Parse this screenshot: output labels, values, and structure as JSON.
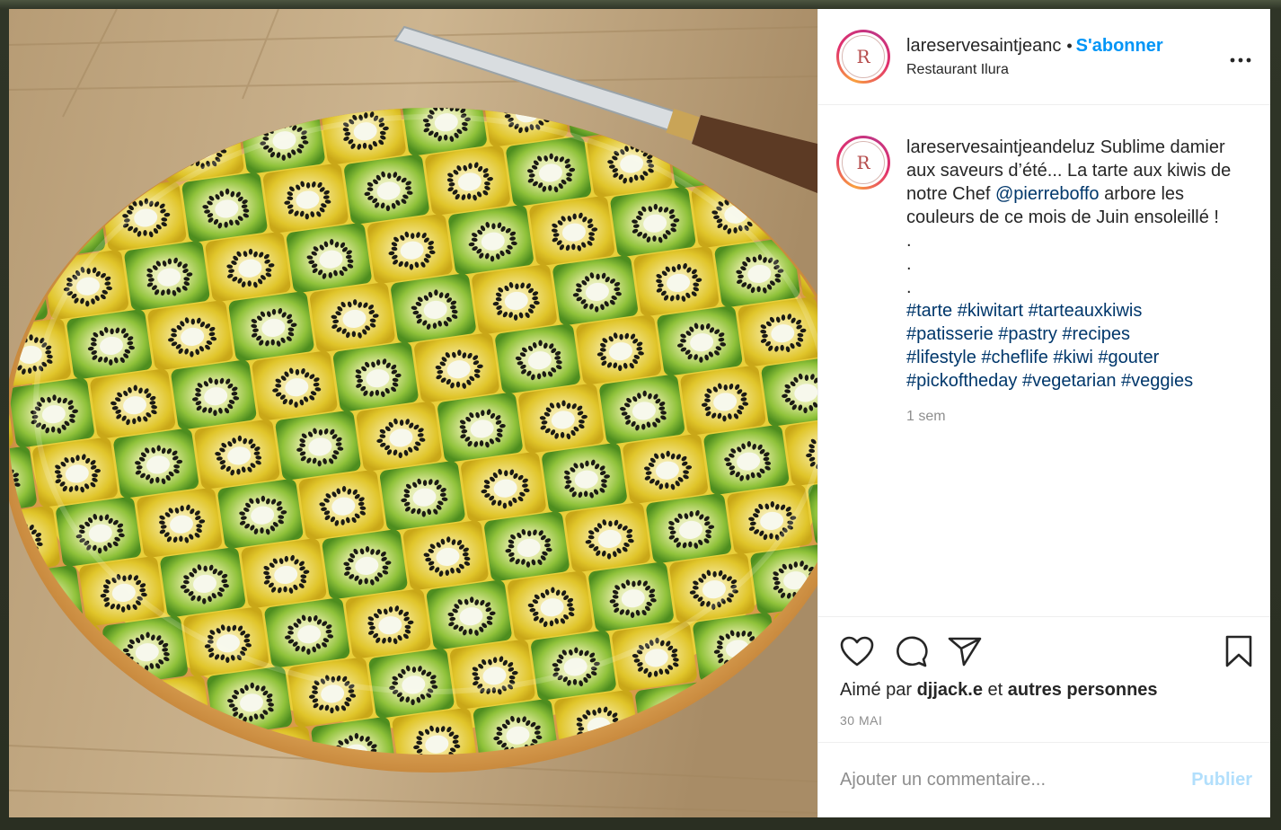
{
  "post": {
    "header": {
      "username": "lareservesaintjeanc",
      "separator": "•",
      "follow_label": "S'abonner",
      "location": "Restaurant Ilura",
      "avatar_letter": "R",
      "more_icon": "more-horizontal-icon"
    },
    "caption": {
      "username": "lareservesaintjeandeluz",
      "text_before_mention": "Sublime damier aux saveurs d’été... La tarte aux kiwis de notre Chef",
      "mention": "@pierreboffo",
      "text_after_mention": "arbore les couleurs de ce mois de Juin ensoleillé !",
      "dots": [
        ".",
        ".",
        "."
      ],
      "hashtags": [
        "#tarte #kiwitart #tarteauxkiwis",
        "#patisserie #pastry #recipes",
        "#lifestyle #cheflife #kiwi #gouter",
        "#pickoftheday #vegetarian #veggies"
      ],
      "time": "1 sem"
    },
    "actions": {
      "like_icon": "heart-icon",
      "comment_icon": "comment-icon",
      "share_icon": "send-icon",
      "save_icon": "bookmark-icon"
    },
    "likes": {
      "prefix": "Aimé par",
      "user": "djjack.e",
      "middle": "et",
      "suffix": "autres personnes"
    },
    "date": "30 MAI",
    "comment_input": {
      "placeholder": "Ajouter un commentaire...",
      "publish_label": "Publier"
    },
    "colors": {
      "accent": "#0095f6",
      "link": "#00376b",
      "muted": "#8e8e8e",
      "publish_disabled": "#b2dffc"
    }
  }
}
